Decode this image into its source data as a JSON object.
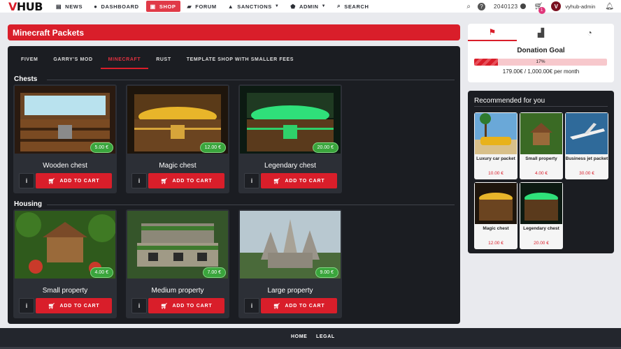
{
  "brand": {
    "logo_part1": "V",
    "logo_part2": "HUB"
  },
  "nav": {
    "items": [
      {
        "label": "NEWS",
        "icon": "newspaper-icon"
      },
      {
        "label": "DASHBOARD",
        "icon": "user-icon"
      },
      {
        "label": "SHOP",
        "icon": "shop-icon"
      },
      {
        "label": "FORUM",
        "icon": "chat-icon"
      },
      {
        "label": "SANCTIONS",
        "icon": "warning-icon"
      },
      {
        "label": "ADMIN",
        "icon": "shield-icon"
      },
      {
        "label": "SEARCH",
        "icon": "search-icon"
      }
    ],
    "balance": "2040123",
    "cart_count": "1",
    "username": "vyhub-admin",
    "avatar_letter": "V"
  },
  "page": {
    "title": "Minecraft Packets"
  },
  "tabs": [
    "FIVEM",
    "GARRY'S MOD",
    "MINECRAFT",
    "RUST",
    "TEMPLATE SHOP WITH SMALLER FEES"
  ],
  "active_tab": "MINECRAFT",
  "sections": {
    "chests": {
      "title": "Chests",
      "products": [
        {
          "name": "Wooden chest",
          "price": "5.00 €"
        },
        {
          "name": "Magic chest",
          "price": "12.00 €"
        },
        {
          "name": "Legendary chest",
          "price": "20.00 €"
        }
      ]
    },
    "housing": {
      "title": "Housing",
      "products": [
        {
          "name": "Small property",
          "price": "4.00 €"
        },
        {
          "name": "Medium property",
          "price": "7.00 €"
        },
        {
          "name": "Large property",
          "price": "9.00 €"
        }
      ]
    }
  },
  "product_buttons": {
    "info": "i",
    "add_to_cart": "ADD TO CART"
  },
  "donation": {
    "title": "Donation Goal",
    "percent_label": "17%",
    "progress": 0.179,
    "amount": "179.00€ / 1,000.00€ per month"
  },
  "recommended": {
    "title": "Recommended for you",
    "items": [
      {
        "name": "Luxury car packet",
        "price": "10.00 €"
      },
      {
        "name": "Small property",
        "price": "4.00 €"
      },
      {
        "name": "Business jet packet",
        "price": "30.00 €"
      },
      {
        "name": "Magic chest",
        "price": "12.00 €"
      },
      {
        "name": "Legendary chest",
        "price": "20.00 €"
      }
    ]
  },
  "footer": {
    "links": [
      "HOME",
      "LEGAL"
    ]
  },
  "colors": {
    "accent": "#d91e2a",
    "panel": "#1b1d22",
    "card": "#2c2f36",
    "price_badge": "#3aa53c"
  }
}
